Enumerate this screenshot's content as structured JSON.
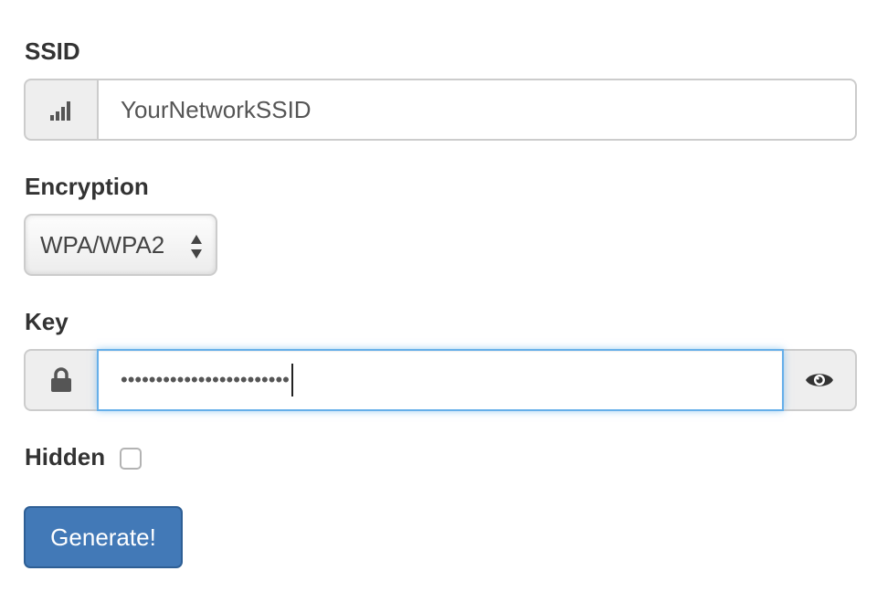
{
  "ssid": {
    "label": "SSID",
    "icon": "signal-bars-icon",
    "value": "YourNetworkSSID"
  },
  "encryption": {
    "label": "Encryption",
    "selected": "WPA/WPA2"
  },
  "key": {
    "label": "Key",
    "masked_value": "••••••••••••••••••••••••",
    "left_icon": "lock-icon",
    "right_icon": "eye-icon"
  },
  "hidden": {
    "label": "Hidden",
    "checked": false
  },
  "generate_button": {
    "label": "Generate!"
  },
  "colors": {
    "primary_button": "#4279b7",
    "focus_border": "#66afe9",
    "addon_bg": "#eeeeee",
    "text": "#333333"
  }
}
